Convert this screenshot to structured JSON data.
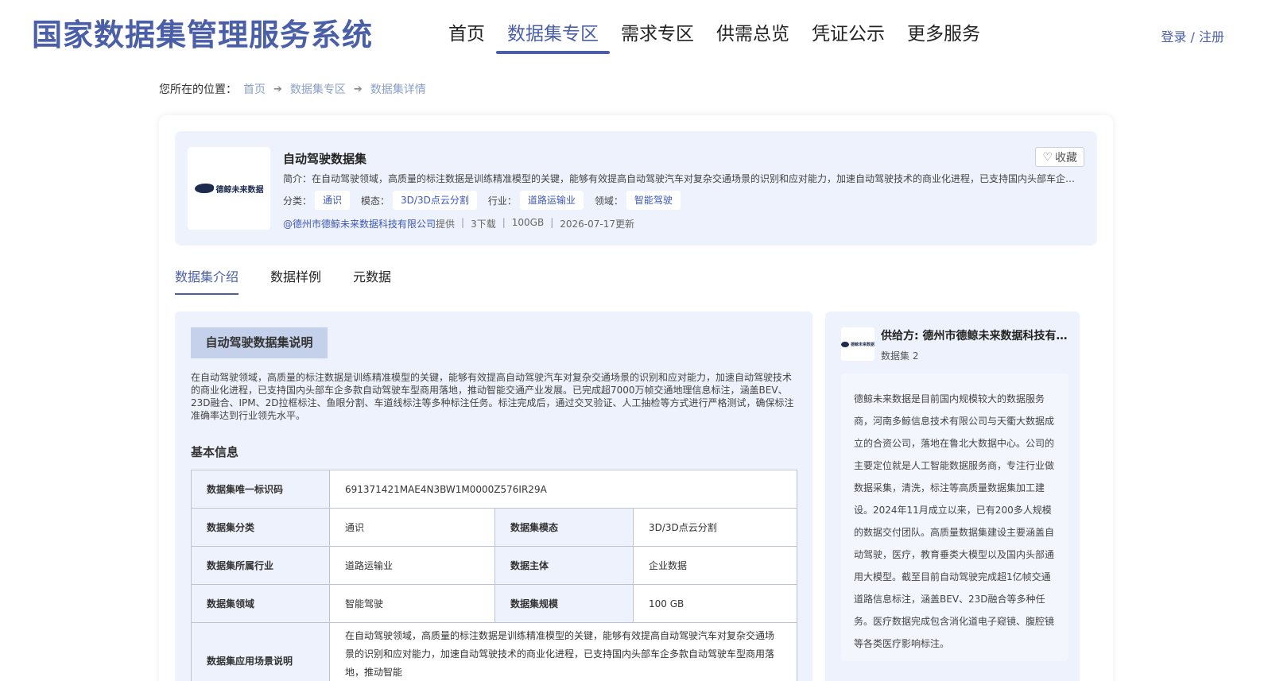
{
  "header": {
    "title": "国家数据集管理服务系统",
    "nav": [
      {
        "label": "首页"
      },
      {
        "label": "数据集专区",
        "active": true
      },
      {
        "label": "需求专区"
      },
      {
        "label": "供需总览"
      },
      {
        "label": "凭证公示"
      },
      {
        "label": "更多服务"
      }
    ],
    "login_label": "登录",
    "login_sep": " / ",
    "register_label": "注册"
  },
  "breadcrumb": {
    "prefix": "您所在的位置：",
    "items": [
      "首页",
      "数据集专区",
      "数据集详情"
    ]
  },
  "dataset": {
    "thumb_text": "德鲸未来数据",
    "title": "自动驾驶数据集",
    "intro": "简介：在自动驾驶领域，高质量的标注数据是训练精准模型的关键，能够有效提高自动驾驶汽车对复杂交通场景的识别和应对能力，加速自动驾驶技术的商业化进程，已支持国内头部车企多款自动驾驶车型商用落地，推动智能交通产业发展。",
    "favorite_label": "收藏",
    "tags": [
      {
        "label": "分类：",
        "value": "通识"
      },
      {
        "label": "模态：",
        "value": "3D/3D点云分割"
      },
      {
        "label": "行业：",
        "value": "道路运输业"
      },
      {
        "label": "领域：",
        "value": "智能驾驶"
      }
    ],
    "provider": "@德州市德鲸未来数据科技有限公司",
    "provider_suffix": "提供",
    "downloads": "3下载",
    "size": "100GB",
    "updated": "2026-07-17更新"
  },
  "tabs": [
    {
      "label": "数据集介绍",
      "active": true
    },
    {
      "label": "数据样例"
    },
    {
      "label": "元数据"
    }
  ],
  "description": {
    "section_title": "自动驾驶数据集说明",
    "text": "在自动驾驶领域，高质量的标注数据是训练精准模型的关键，能够有效提高自动驾驶汽车对复杂交通场景的识别和应对能力，加速自动驾驶技术的商业化进程，已支持国内头部车企多款自动驾驶车型商用落地，推动智能交通产业发展。已完成超7000万帧交通地理信息标注，涵盖BEV、23D融合、IPM、2D拉框标注、鱼眼分割、车道线标注等多种标注任务。标注完成后，通过交叉验证、人工抽检等方式进行严格测试，确保标注准确率达到行业领先水平。"
  },
  "basic_info": {
    "title": "基本信息",
    "id_label": "数据集唯一标识码",
    "id_value": "691371421MAE4N3BW1M0000Z576IR29A",
    "category_label": "数据集分类",
    "category_value": "通识",
    "modality_label": "数据集模态",
    "modality_value": "3D/3D点云分割",
    "industry_label": "数据集所属行业",
    "industry_value": "道路运输业",
    "subject_label": "数据主体",
    "subject_value": "企业数据",
    "domain_label": "数据集领域",
    "domain_value": "智能驾驶",
    "scale_label": "数据集规模",
    "scale_value": "100 GB",
    "scenario_label": "数据集应用场景说明",
    "scenario_value": "在自动驾驶领域，高质量的标注数据是训练精准模型的关键，能够有效提高自动驾驶汽车对复杂交通场景的识别和应对能力，加速自动驾驶技术的商业化进程，已支持国内头部车企多款自动驾驶车型商用落地，推动智能"
  },
  "supplier": {
    "logo_text": "德鲸未来数据",
    "name": "供给方: 德州市德鲸未来数据科技有限公司",
    "count": "数据集 2",
    "description": "德鲸未来数据是目前国内规模较大的数据服务商，河南多鲸信息技术有限公司与天衢大数据成立的合资公司，落地在鲁北大数据中心。公司的主要定位就是人工智能数据服务商，专注行业做数据采集，清洗，标注等高质量数据集加工建设。2024年11月成立以来，已有200多人规模的数据交付团队。高质量数据集建设主要涵盖自动驾驶，医疗，教育垂类大模型以及国内头部通用大模型。截至目前自动驾驶完成超1亿帧交通道路信息标注，涵盖BEV、23D融合等多种任务。医疗数据完成包含消化道电子窥镜、腹腔镜等各类医疗影响标注。"
  },
  "colors": {
    "brand": "#4a5fa8",
    "panel_bg": "#eef2fc",
    "tag_text": "#3d57b8"
  }
}
